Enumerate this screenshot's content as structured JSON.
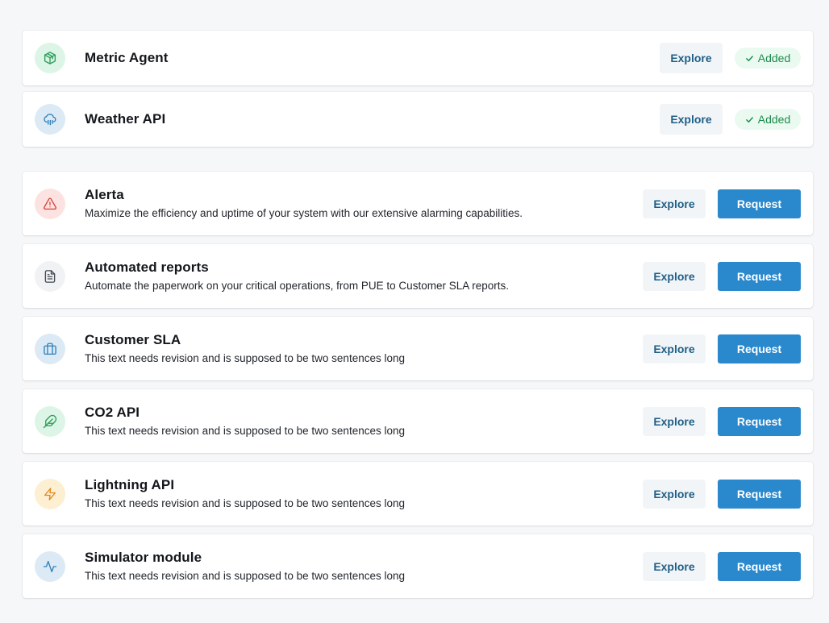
{
  "colors": {
    "accent": "#2a88cc",
    "explore_text": "#1f5f86",
    "added_text": "#1e8a4c",
    "added_bg": "#eafaf1"
  },
  "added_integrations": [
    {
      "title": "Metric Agent",
      "icon": "cube-icon",
      "icon_color": "#2e9d5a",
      "icon_bg": "#dcf5e6",
      "explore_label": "Explore",
      "status_label": "Added"
    },
    {
      "title": "Weather API",
      "icon": "cloud-rain-icon",
      "icon_color": "#2f7fb8",
      "icon_bg": "#dceaf5",
      "explore_label": "Explore",
      "status_label": "Added"
    }
  ],
  "available_integrations": [
    {
      "title": "Alerta",
      "description": "Maximize the efficiency and uptime of your system with our extensive alarming capabilities.",
      "icon": "warning-icon",
      "icon_color": "#d9443a",
      "icon_bg": "#fce3e1",
      "explore_label": "Explore",
      "request_label": "Request"
    },
    {
      "title": "Automated reports",
      "description": "Automate the paperwork on your critical operations, from PUE to Customer SLA reports.",
      "icon": "document-icon",
      "icon_color": "#454a52",
      "icon_bg": "#f1f2f4",
      "explore_label": "Explore",
      "request_label": "Request"
    },
    {
      "title": "Customer SLA",
      "description": "This text needs revision and is supposed to be two sentences long",
      "icon": "briefcase-icon",
      "icon_color": "#2f7fb8",
      "icon_bg": "#dceaf5",
      "explore_label": "Explore",
      "request_label": "Request"
    },
    {
      "title": "CO2 API",
      "description": "This text needs revision and is supposed to be two sentences long",
      "icon": "feather-icon",
      "icon_color": "#2e9d5a",
      "icon_bg": "#dcf5e6",
      "explore_label": "Explore",
      "request_label": "Request"
    },
    {
      "title": "Lightning API",
      "description": "This text needs revision and is supposed to be two sentences long",
      "icon": "lightning-icon",
      "icon_color": "#e08a1e",
      "icon_bg": "#fdefd2",
      "explore_label": "Explore",
      "request_label": "Request"
    },
    {
      "title": "Simulator module",
      "description": "This text needs revision and is supposed to be two sentences long",
      "icon": "activity-icon",
      "icon_color": "#2f7fb8",
      "icon_bg": "#dceaf5",
      "explore_label": "Explore",
      "request_label": "Request"
    }
  ]
}
